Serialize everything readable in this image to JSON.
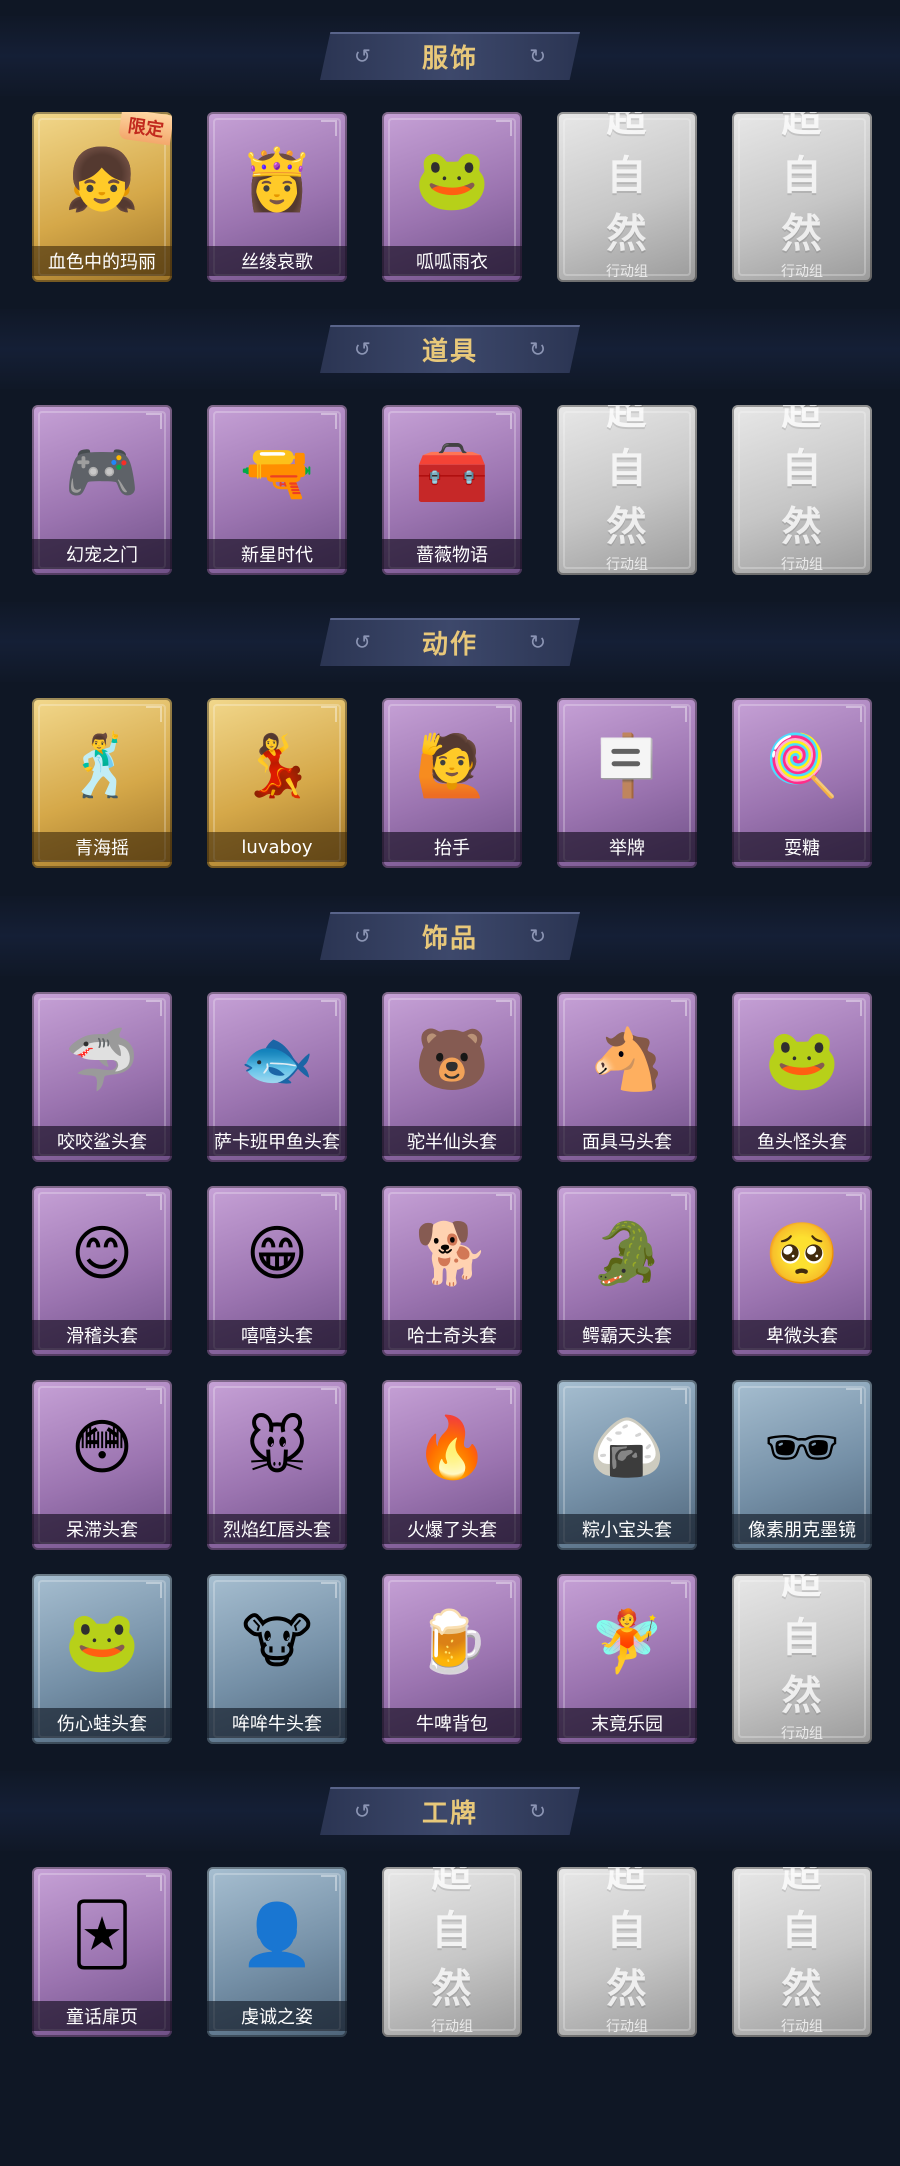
{
  "placeholder": {
    "title": "超自然",
    "subtitle": "行动组"
  },
  "sections": [
    {
      "title": "服饰",
      "items": [
        {
          "label": "血色中的玛丽",
          "rarity": "gold",
          "icon": "doll-icon",
          "glyph": "👧",
          "badge": "限定"
        },
        {
          "label": "丝绫哀歌",
          "rarity": "purple",
          "icon": "doll-icon",
          "glyph": "👸"
        },
        {
          "label": "呱呱雨衣",
          "rarity": "purple",
          "icon": "raincoat-icon",
          "glyph": "🐸"
        },
        {
          "placeholder": true
        },
        {
          "placeholder": true
        }
      ]
    },
    {
      "title": "道具",
      "items": [
        {
          "label": "幻宠之门",
          "rarity": "purple",
          "icon": "tamagotchi-icon",
          "glyph": "🎮"
        },
        {
          "label": "新星时代",
          "rarity": "purple",
          "icon": "revolver-icon",
          "glyph": "🔫"
        },
        {
          "label": "蔷薇物语",
          "rarity": "purple",
          "icon": "medkit-icon",
          "glyph": "🧰"
        },
        {
          "placeholder": true
        },
        {
          "placeholder": true
        }
      ]
    },
    {
      "title": "动作",
      "items": [
        {
          "label": "青海摇",
          "rarity": "gold",
          "icon": "dance-icon",
          "glyph": "🕺"
        },
        {
          "label": "luvaboy",
          "rarity": "gold",
          "icon": "dance-icon",
          "glyph": "💃"
        },
        {
          "label": "抬手",
          "rarity": "purple",
          "icon": "raise-hand-icon",
          "glyph": "🙋"
        },
        {
          "label": "举牌",
          "rarity": "purple",
          "icon": "hold-sign-icon",
          "glyph": "🪧"
        },
        {
          "label": "耍糖",
          "rarity": "purple",
          "icon": "candy-icon",
          "glyph": "🍭"
        }
      ]
    },
    {
      "title": "饰品",
      "items": [
        {
          "label": "咬咬鲨头套",
          "rarity": "purple",
          "icon": "shark-icon",
          "glyph": "🦈"
        },
        {
          "label": "萨卡班甲鱼头套",
          "rarity": "purple",
          "icon": "fish-icon",
          "glyph": "🐟"
        },
        {
          "label": "驼半仙头套",
          "rarity": "purple",
          "icon": "bear-icon",
          "glyph": "🐻"
        },
        {
          "label": "面具马头套",
          "rarity": "purple",
          "icon": "horse-icon",
          "glyph": "🐴"
        },
        {
          "label": "鱼头怪头套",
          "rarity": "purple",
          "icon": "fish-head-icon",
          "glyph": "🐸"
        },
        {
          "label": "滑稽头套",
          "rarity": "purple",
          "icon": "smile-icon",
          "glyph": "😊"
        },
        {
          "label": "嘻嘻头套",
          "rarity": "purple",
          "icon": "grin-icon",
          "glyph": "😁"
        },
        {
          "label": "哈士奇头套",
          "rarity": "purple",
          "icon": "dog-icon",
          "glyph": "🐕"
        },
        {
          "label": "鳄霸天头套",
          "rarity": "purple",
          "icon": "crocodile-icon",
          "glyph": "🐊"
        },
        {
          "label": "卑微头套",
          "rarity": "purple",
          "icon": "sad-face-icon",
          "glyph": "🥺"
        },
        {
          "label": "呆滞头套",
          "rarity": "purple",
          "icon": "stare-face-icon",
          "glyph": "😳"
        },
        {
          "label": "烈焰红唇头套",
          "rarity": "purple",
          "icon": "pikachu-icon",
          "glyph": "🐭"
        },
        {
          "label": "火爆了头套",
          "rarity": "purple",
          "icon": "fire-icon",
          "glyph": "🔥"
        },
        {
          "label": "粽小宝头套",
          "rarity": "blue",
          "icon": "zongzi-icon",
          "glyph": "🍙"
        },
        {
          "label": "像素朋克墨镜",
          "rarity": "blue",
          "icon": "sunglasses-icon",
          "glyph": "🕶"
        },
        {
          "label": "伤心蛙头套",
          "rarity": "blue",
          "icon": "frog-icon",
          "glyph": "🐸"
        },
        {
          "label": "哞哞牛头套",
          "rarity": "blue",
          "icon": "cow-icon",
          "glyph": "🐮"
        },
        {
          "label": "牛啤背包",
          "rarity": "purple",
          "icon": "backpack-icon",
          "glyph": "🍺"
        },
        {
          "label": "末竟乐园",
          "rarity": "purple",
          "icon": "figure-icon",
          "glyph": "🧚"
        },
        {
          "placeholder": true
        }
      ]
    },
    {
      "title": "工牌",
      "items": [
        {
          "label": "童话扉页",
          "rarity": "purple",
          "icon": "card-icon",
          "glyph": "🃏"
        },
        {
          "label": "虔诚之姿",
          "rarity": "blue",
          "icon": "silhouette-icon",
          "glyph": "👤"
        },
        {
          "placeholder": true
        },
        {
          "placeholder": true
        },
        {
          "placeholder": true
        }
      ]
    }
  ]
}
